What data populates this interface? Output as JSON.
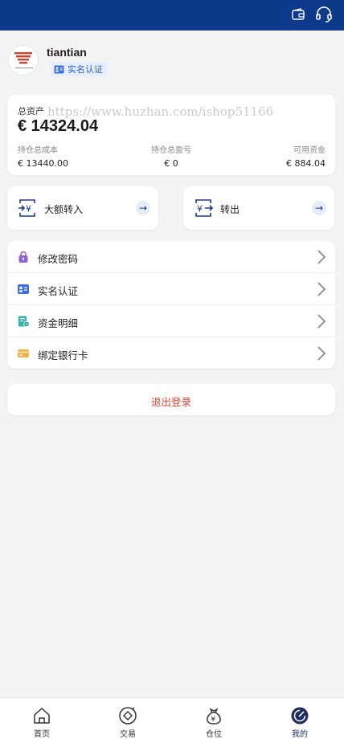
{
  "profile": {
    "username": "tiantian",
    "verify_badge": "实名认证"
  },
  "assets": {
    "total_label": "总资产",
    "total_value": "€ 14324.04",
    "watermark": "https://www.huzhan.com/ishop51166",
    "cost_label": "持仓总成本",
    "cost_value": "€ 13440.00",
    "pnl_label": "持仓总盈亏",
    "pnl_value": "€ 0",
    "available_label": "可用资金",
    "available_value": "€ 884.04"
  },
  "transfers": {
    "in_label": "大额转入",
    "out_label": "转出",
    "arrow": "→"
  },
  "menu": [
    {
      "label": "修改密码",
      "icon": "lock-icon",
      "color": "#8e62d9"
    },
    {
      "label": "实名认证",
      "icon": "id-card-icon",
      "color": "#3d6fe0"
    },
    {
      "label": "资金明细",
      "icon": "fund-detail-icon",
      "color": "#2bb5a6"
    },
    {
      "label": "绑定银行卡",
      "icon": "bank-card-icon",
      "color": "#f2b143"
    }
  ],
  "logout": {
    "label": "退出登录",
    "color": "#e54535"
  },
  "nav": [
    {
      "label": "首页",
      "icon": "home-icon"
    },
    {
      "label": "交易",
      "icon": "trade-icon"
    },
    {
      "label": "仓位",
      "icon": "position-bag-icon"
    },
    {
      "label": "我的",
      "icon": "profile-compass-icon",
      "active": true
    }
  ],
  "colors": {
    "header": "#0e3a8c",
    "accent": "#1e2d63"
  }
}
